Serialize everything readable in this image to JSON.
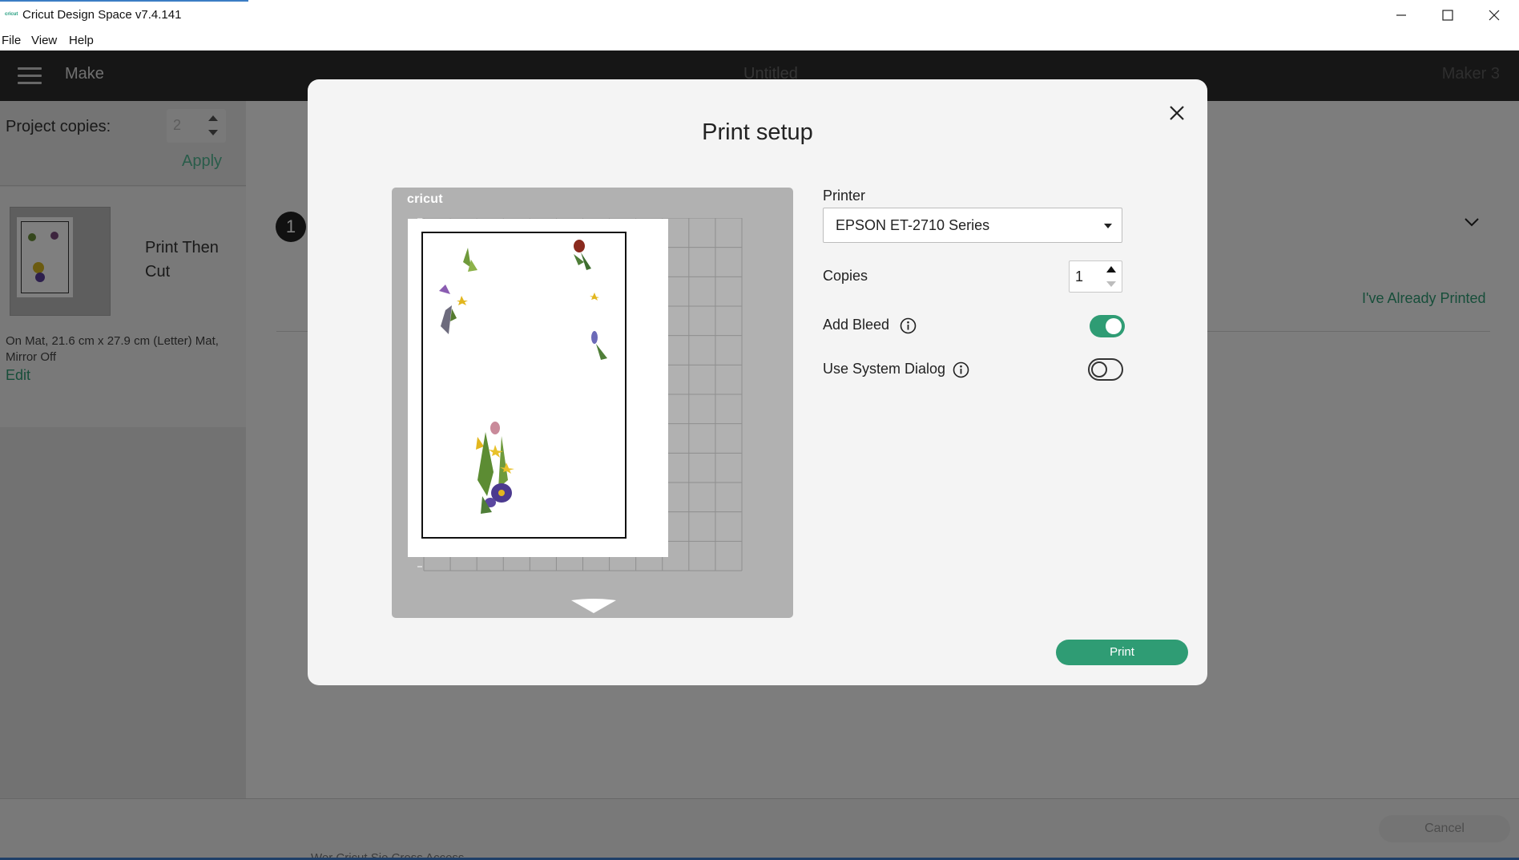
{
  "window": {
    "title": "Cricut Design Space  v7.4.141",
    "logo_text": "cricut"
  },
  "menubar": {
    "items": [
      "File",
      "View",
      "Help"
    ]
  },
  "header": {
    "section": "Make",
    "project_name": "Untitled",
    "machine": "Maker 3"
  },
  "left_panel": {
    "copies_label": "Project copies:",
    "copies_value": "2",
    "apply_label": "Apply",
    "mat": {
      "name": "Print Then Cut",
      "description": "On Mat, 21.6 cm x 27.9 cm (Letter) Mat, Mirror Off",
      "edit_label": "Edit"
    }
  },
  "main": {
    "step_number": "1",
    "already_printed_label": "I've Already Printed",
    "cancel_label": "Cancel",
    "bottom_hint": "Wer Cricut Sie Cross Access ..."
  },
  "modal": {
    "title": "Print setup",
    "mat_brand": "cricut",
    "printer_label": "Printer",
    "printer_value": "EPSON ET-2710 Series",
    "copies_label": "Copies",
    "copies_value": "1",
    "add_bleed_label": "Add Bleed",
    "add_bleed_on": true,
    "system_dialog_label": "Use System Dialog",
    "system_dialog_on": false,
    "print_label": "Print"
  },
  "colors": {
    "accent_green": "#2f9c74",
    "header_dark": "#2d2d2d",
    "mat_grey": "#b1b1b1"
  }
}
